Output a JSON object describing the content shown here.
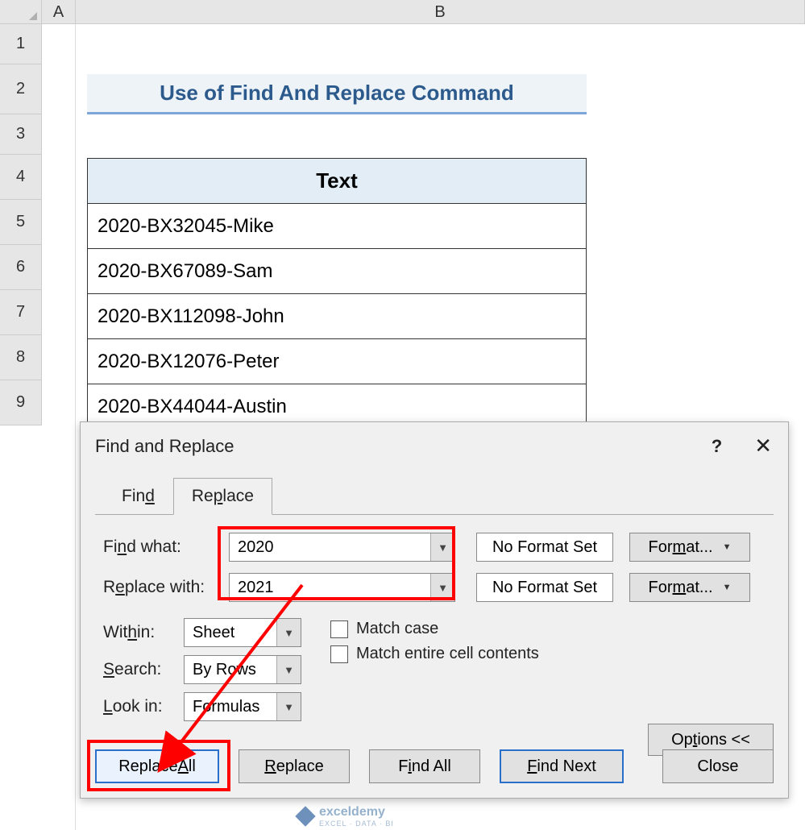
{
  "columns": {
    "A": "A",
    "B": "B"
  },
  "rows": [
    "1",
    "2",
    "3",
    "4",
    "5",
    "6",
    "7",
    "8",
    "9"
  ],
  "title": "Use of Find And Replace Command",
  "table": {
    "header": "Text",
    "rows": [
      "2020-BX32045-Mike",
      "2020-BX67089-Sam",
      "2020-BX112098-John",
      "2020-BX12076-Peter",
      "2020-BX44044-Austin"
    ]
  },
  "dialog": {
    "title": "Find and Replace",
    "tabs": {
      "find": "Find",
      "replace": "Replace"
    },
    "labels": {
      "find_what": "Find what:",
      "replace_with": "Replace with:",
      "within": "Within:",
      "search": "Search:",
      "look_in": "Look in:",
      "no_format": "No Format Set",
      "format_btn": "Format...",
      "match_case": "Match case",
      "match_entire": "Match entire cell contents",
      "options": "Options <<"
    },
    "values": {
      "find_what": "2020",
      "replace_with": "2021",
      "within": "Sheet",
      "search": "By Rows",
      "look_in": "Formulas"
    },
    "buttons": {
      "replace_all": "Replace All",
      "replace": "Replace",
      "find_all": "Find All",
      "find_next": "Find Next",
      "close": "Close"
    }
  },
  "watermark": {
    "name": "exceldemy",
    "sub": "EXCEL · DATA · BI"
  }
}
